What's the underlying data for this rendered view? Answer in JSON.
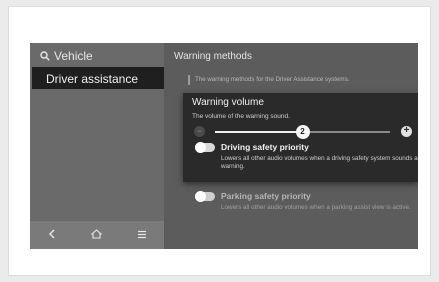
{
  "sidebar": {
    "vehicle_label": "Vehicle",
    "selected_item": "Driver assistance",
    "nav": {
      "back_icon": "<",
      "home_icon": "home-icon",
      "menu_icon": "menu-icon"
    }
  },
  "main": {
    "title": "Warning methods",
    "description": "The warning methods for the Driver Assistance systems."
  },
  "popup": {
    "title": "Warning volume",
    "subtitle": "The volume of the warning sound.",
    "volume": 2,
    "volume_max": 4,
    "minus_label": "−",
    "plus_label": "+"
  },
  "options": [
    {
      "label": "Driving safety priority",
      "description": "Lowers all other audio volumes when a driving safety system sounds a warning.",
      "enabled": false
    },
    {
      "label": "Parking safety priority",
      "description": "Lowers all other audio volumes when a parking assist view is active.",
      "enabled": false
    }
  ],
  "colors": {
    "screen_bg": "#5c5c5c",
    "popup_bg": "#2a2a2a",
    "selected_item_bg": "#1f1f1f"
  }
}
